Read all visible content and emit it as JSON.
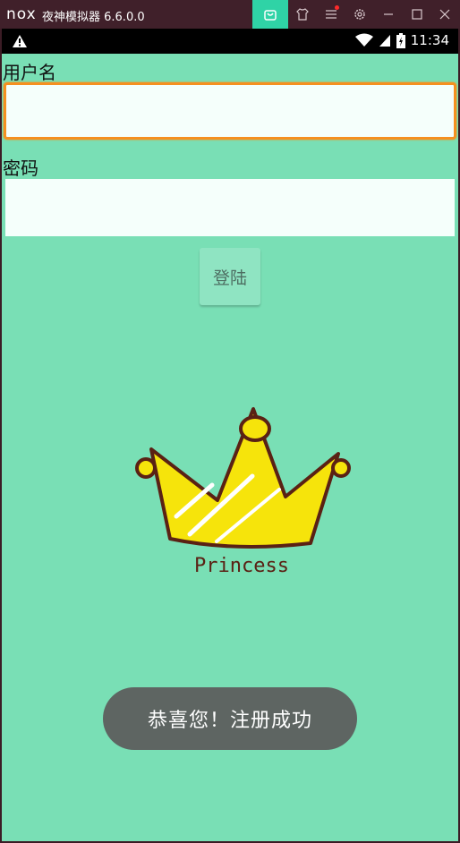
{
  "emulator": {
    "logo": "nox",
    "title": "夜神模拟器 6.6.0.0",
    "buttons": [
      "bag-icon",
      "shirt-icon",
      "menu-icon",
      "settings-icon",
      "minimize-icon",
      "maximize-icon",
      "close-icon"
    ]
  },
  "statusbar": {
    "time": "11:34"
  },
  "form": {
    "username_label": "用户名",
    "username_value": "",
    "password_label": "密码",
    "password_value": "",
    "login_label": "登陆"
  },
  "image": {
    "caption": "Princess"
  },
  "toast": {
    "message": "恭喜您！注册成功"
  },
  "colors": {
    "background": "#79dfb5",
    "accent_focus": "#f5901f",
    "titlebar": "#40202a",
    "active_tab": "#2fd3a6"
  }
}
